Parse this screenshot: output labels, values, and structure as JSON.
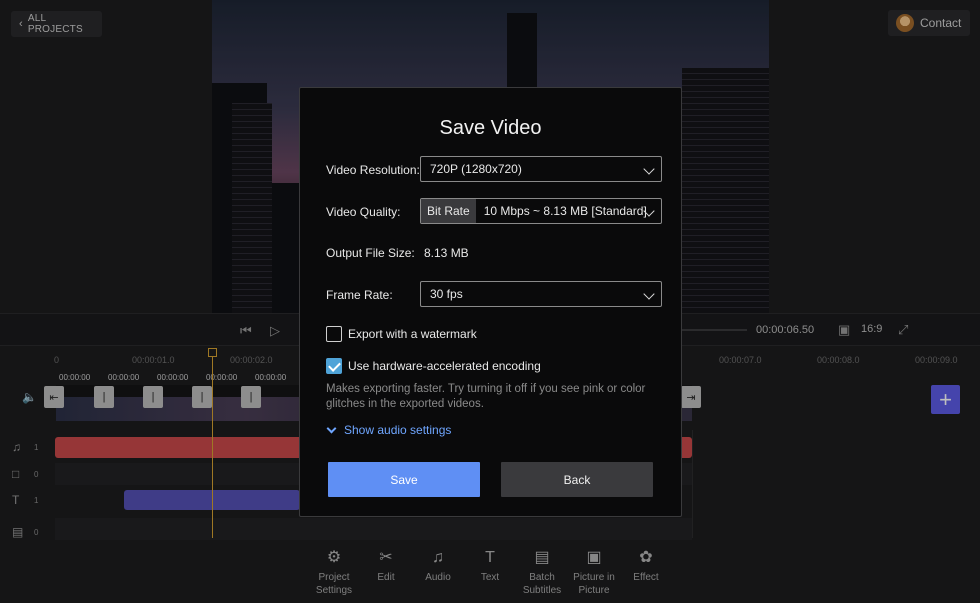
{
  "header": {
    "all_projects_label": "ALL PROJECTS",
    "contact_label": "Contact"
  },
  "player": {
    "timecode": "00:00:06.50",
    "aspect_ratio": "16:9"
  },
  "timeline": {
    "ruler_ticks": [
      "0",
      "00:00:01.0",
      "00:00:02.0",
      "00:00:07.0",
      "00:00:08.0",
      "00:00:09.0"
    ],
    "clip_thumb_labels": [
      "00:00:00",
      "00:00:00",
      "00:00:00",
      "00:00:00",
      "00:00:00"
    ],
    "track_counts": {
      "audio": "1",
      "overlay": "0",
      "text": "1",
      "subtitle": "0"
    }
  },
  "toolbar": {
    "items": [
      {
        "icon": "gear-icon",
        "label": "Project Settings"
      },
      {
        "icon": "scissors-icon",
        "label": "Edit"
      },
      {
        "icon": "music-icon",
        "label": "Audio"
      },
      {
        "icon": "text-icon",
        "label": "Text"
      },
      {
        "icon": "subtitles-icon",
        "label": "Batch Subtitles"
      },
      {
        "icon": "pip-icon",
        "label": "Picture in Picture"
      },
      {
        "icon": "effect-icon",
        "label": "Effect"
      }
    ]
  },
  "modal": {
    "title": "Save Video",
    "resolution_label": "Video Resolution:",
    "resolution_value": "720P (1280x720)",
    "quality_label": "Video Quality:",
    "quality_tag": "Bit Rate",
    "quality_value": "10 Mbps ~ 8.13 MB [Standard]",
    "filesize_label": "Output File Size:",
    "filesize_value": "8.13 MB",
    "framerate_label": "Frame Rate:",
    "framerate_value": "30 fps",
    "watermark_label": "Export with a watermark",
    "watermark_checked": false,
    "hw_label": "Use hardware-accelerated encoding",
    "hw_checked": true,
    "hw_hint": "Makes exporting faster. Try turning it off if you see pink or color glitches in the exported videos.",
    "audio_settings_label": "Show audio settings",
    "save_label": "Save",
    "back_label": "Back"
  },
  "colors": {
    "accent": "#5f8ff4",
    "checkbox": "#4fa3d8",
    "audio_clip": "#c9484a",
    "text_clip": "#5550b4",
    "playhead": "#d4a030"
  }
}
